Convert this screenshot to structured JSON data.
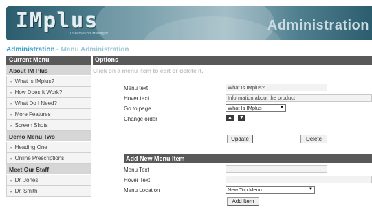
{
  "header": {
    "logo_text": "IMplus",
    "logo_subtext": "Information Manager",
    "title": "Administration"
  },
  "breadcrumb": {
    "link": "Administration",
    "separator": " - ",
    "current": "Menu Administration"
  },
  "left_panel": {
    "title": "Current Menu",
    "sections": [
      {
        "label": "About IM Plus",
        "items": [
          "What Is IMplus?",
          "How Does It Work?",
          "What Do I Need?",
          "More Features",
          "Screen Shots"
        ]
      },
      {
        "label": "Demo Menu Two",
        "items": [
          "Heading One",
          "Online Prescriptions"
        ]
      },
      {
        "label": "Meet Our Staff",
        "items": [
          "Dr. Jones",
          "Dr. Smith"
        ]
      }
    ]
  },
  "options": {
    "title": "Options",
    "hint": "Click on a menu item to edit or delete it.",
    "menu_text_label": "Menu text",
    "menu_text_value": "What Is IMplus?",
    "hover_text_label": "Hover text",
    "hover_text_value": "Information about the product",
    "go_to_page_label": "Go to page",
    "go_to_page_value": "What Is IMplus",
    "change_order_label": "Change order",
    "update_label": "Update",
    "delete_label": "Delete"
  },
  "add_item": {
    "title": "Add New Menu Item",
    "menu_text_label": "Menu Text",
    "hover_text_label": "Hover Text",
    "menu_location_label": "Menu Location",
    "menu_location_value": "New Top Menu",
    "add_label": "Add Item"
  },
  "icons": {
    "up": "chevron-up-icon",
    "down": "chevron-down-icon",
    "dropdown": "dropdown-arrow-icon"
  }
}
